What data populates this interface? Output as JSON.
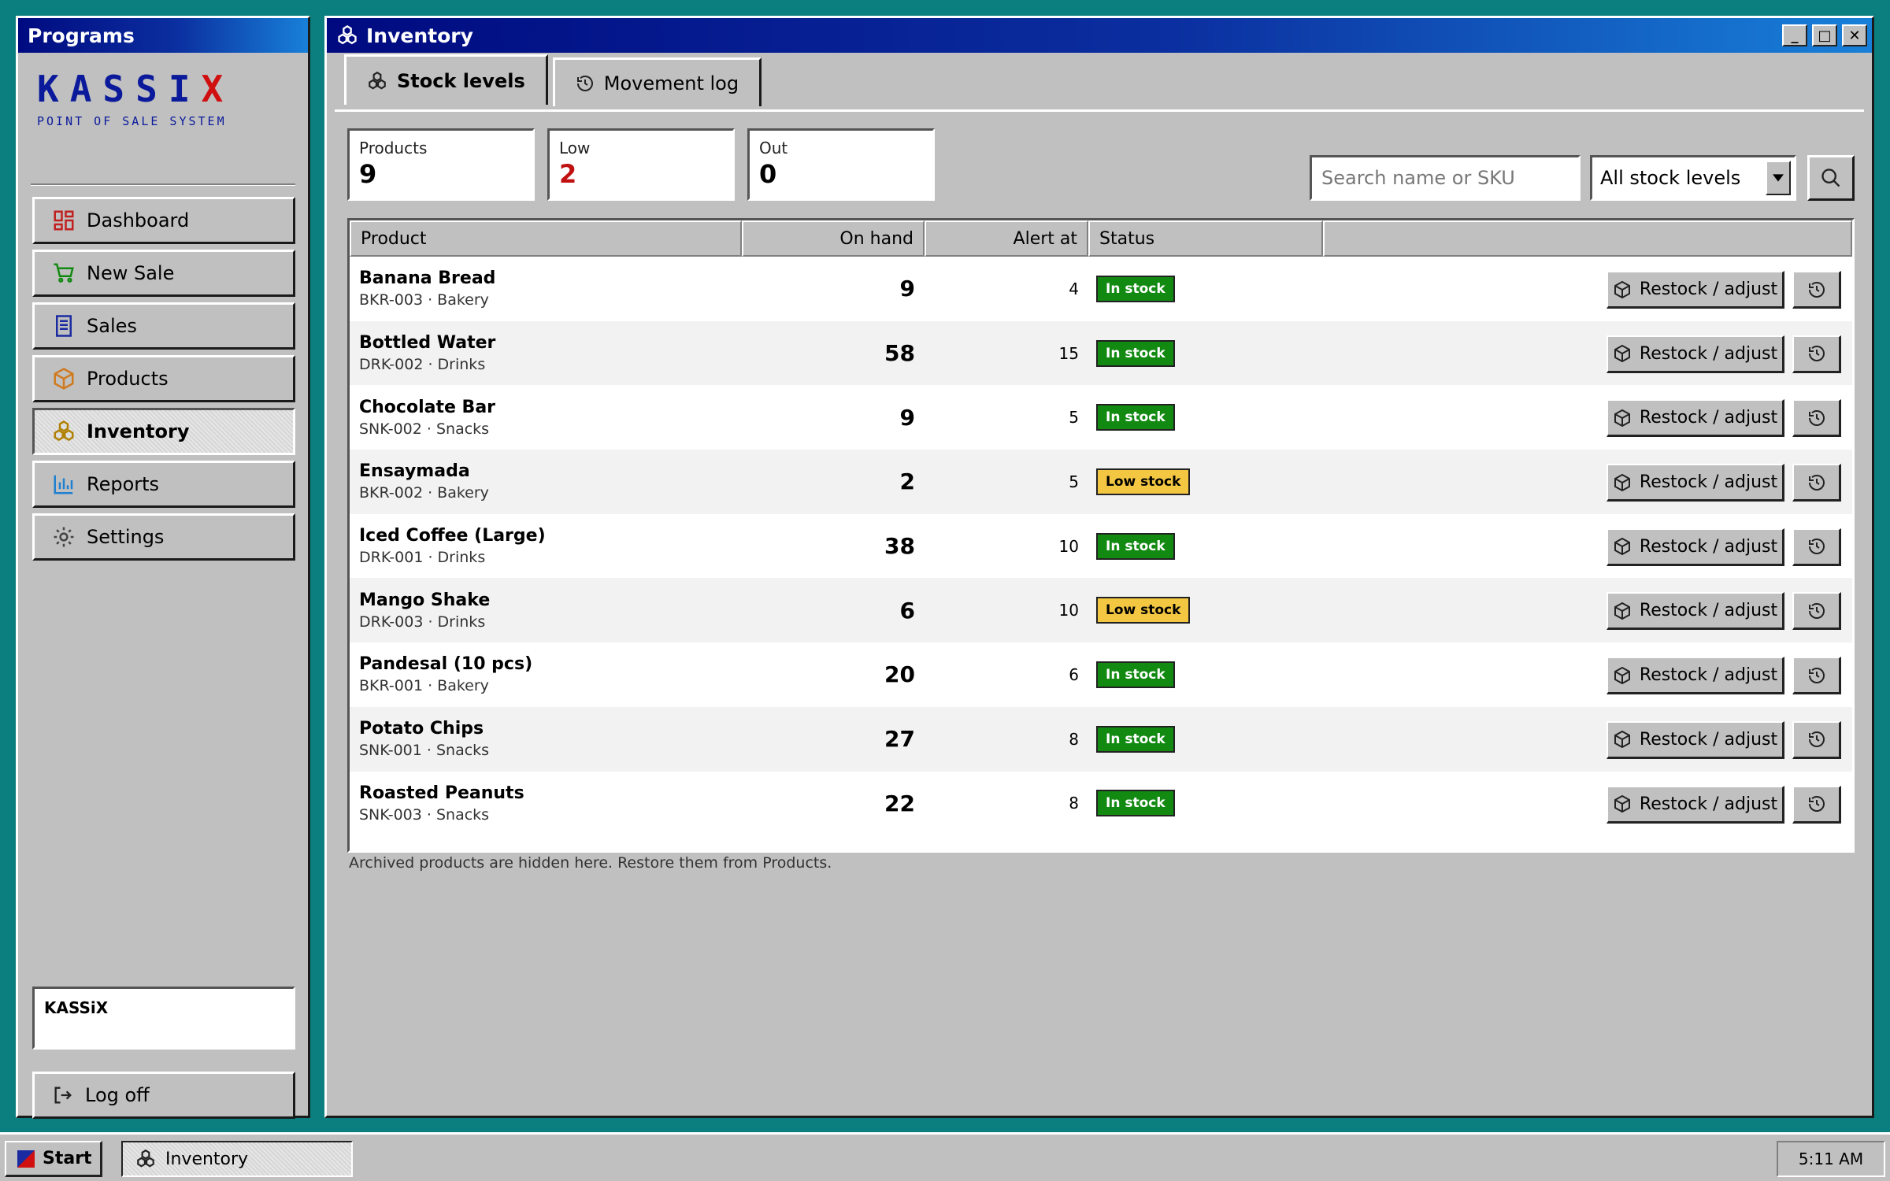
{
  "sidebar": {
    "title": "Programs",
    "logo": {
      "word": "KASSIX",
      "tagline": "POINT OF SALE SYSTEM"
    },
    "items": [
      {
        "label": "Dashboard",
        "icon": "dashboard-icon"
      },
      {
        "label": "New Sale",
        "icon": "cart-icon"
      },
      {
        "label": "Sales",
        "icon": "receipt-icon"
      },
      {
        "label": "Products",
        "icon": "box-icon"
      },
      {
        "label": "Inventory",
        "icon": "boxes-icon"
      },
      {
        "label": "Reports",
        "icon": "bar-chart-icon"
      },
      {
        "label": "Settings",
        "icon": "gear-icon"
      }
    ],
    "active": "Inventory",
    "user": "KASSiX",
    "logoff": "Log off"
  },
  "window": {
    "title": "Inventory",
    "controls": {
      "minimize": "_",
      "maximize": "□",
      "close": "✕"
    },
    "tabs": [
      {
        "label": "Stock levels",
        "icon": "boxes-icon"
      },
      {
        "label": "Movement log",
        "icon": "history-icon"
      }
    ],
    "summary": {
      "products": {
        "label": "Products",
        "value": "9"
      },
      "low": {
        "label": "Low",
        "value": "2"
      },
      "out": {
        "label": "Out",
        "value": "0"
      }
    },
    "search": {
      "placeholder": "Search name or SKU",
      "value": ""
    },
    "filter": {
      "selected": "All stock levels"
    },
    "table": {
      "columns": [
        "Product",
        "On hand",
        "Alert at",
        "Status"
      ],
      "action_label": "Restock / adjust",
      "rows": [
        {
          "name": "Banana Bread",
          "sku": "BKR-003",
          "category": "Bakery",
          "on_hand": "9",
          "alert_at": "4",
          "status": "In stock"
        },
        {
          "name": "Bottled Water",
          "sku": "DRK-002",
          "category": "Drinks",
          "on_hand": "58",
          "alert_at": "15",
          "status": "In stock"
        },
        {
          "name": "Chocolate Bar",
          "sku": "SNK-002",
          "category": "Snacks",
          "on_hand": "9",
          "alert_at": "5",
          "status": "In stock"
        },
        {
          "name": "Ensaymada",
          "sku": "BKR-002",
          "category": "Bakery",
          "on_hand": "2",
          "alert_at": "5",
          "status": "Low stock"
        },
        {
          "name": "Iced Coffee (Large)",
          "sku": "DRK-001",
          "category": "Drinks",
          "on_hand": "38",
          "alert_at": "10",
          "status": "In stock"
        },
        {
          "name": "Mango Shake",
          "sku": "DRK-003",
          "category": "Drinks",
          "on_hand": "6",
          "alert_at": "10",
          "status": "Low stock"
        },
        {
          "name": "Pandesal (10 pcs)",
          "sku": "BKR-001",
          "category": "Bakery",
          "on_hand": "20",
          "alert_at": "6",
          "status": "In stock"
        },
        {
          "name": "Potato Chips",
          "sku": "SNK-001",
          "category": "Snacks",
          "on_hand": "27",
          "alert_at": "8",
          "status": "In stock"
        },
        {
          "name": "Roasted Peanuts",
          "sku": "SNK-003",
          "category": "Snacks",
          "on_hand": "22",
          "alert_at": "8",
          "status": "In stock"
        }
      ]
    },
    "note": "Archived products are hidden here. Restore them from Products."
  },
  "taskbar": {
    "start": "Start",
    "task": "Inventory",
    "clock": "5:11 AM"
  },
  "colors": {
    "desktop": "#0b7f7f",
    "titlebar": "#000a80",
    "in_stock": "#128a12",
    "low_stock": "#f3c742",
    "low_count": "#c01010"
  }
}
